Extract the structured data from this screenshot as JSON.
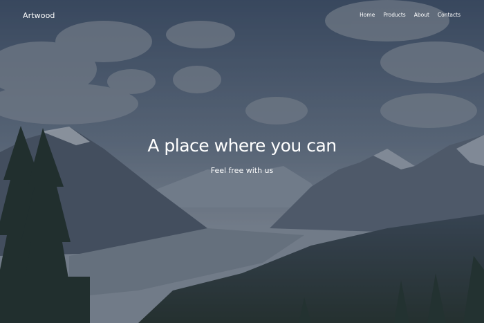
{
  "brand": {
    "name": "Artwood"
  },
  "nav": {
    "items": [
      {
        "label": "Home"
      },
      {
        "label": "Products"
      },
      {
        "label": "About"
      },
      {
        "label": "Contacts"
      }
    ]
  },
  "hero": {
    "headline": "A place where you can",
    "subheadline": "Feel free with us",
    "background": "mountain-landscape-photo"
  },
  "colors": {
    "sky": "#4c5d74",
    "text": "#ffffff",
    "forest": "#1f2e26"
  }
}
